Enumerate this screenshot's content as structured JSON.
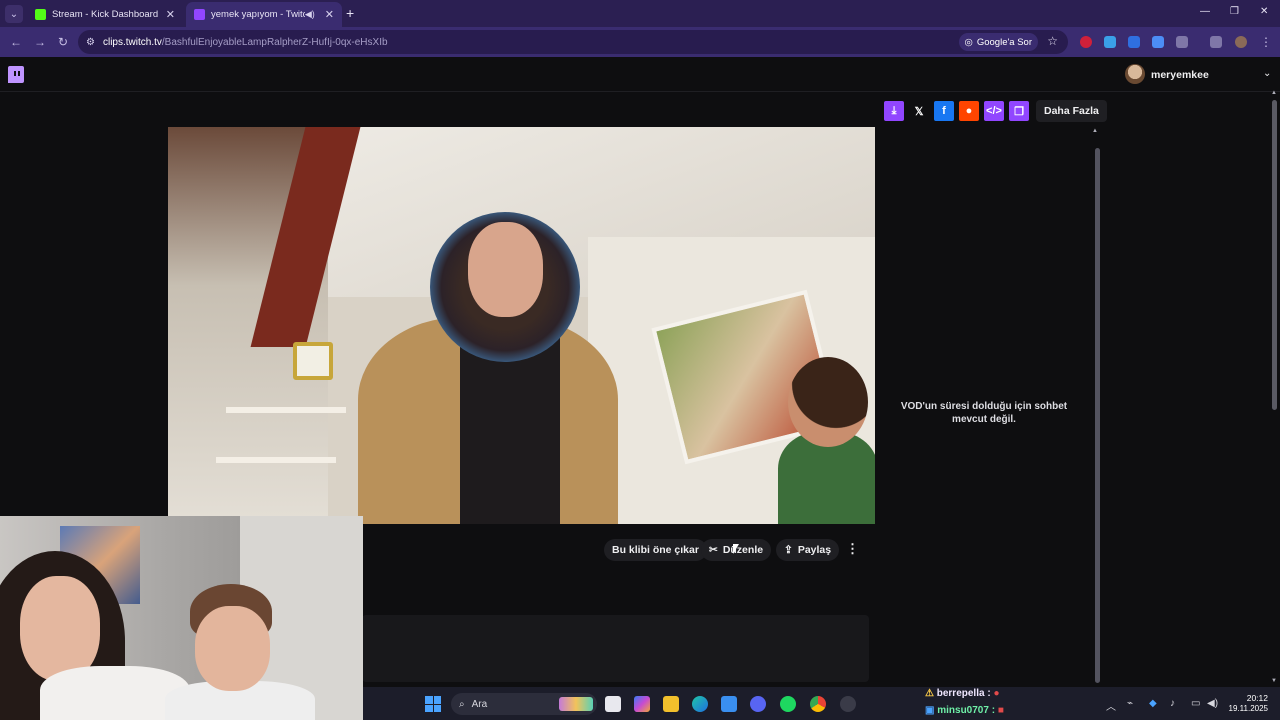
{
  "browser": {
    "tabs": [
      {
        "title": "Stream - Kick Dashboard",
        "active": false,
        "favicon_color": "#53fc18"
      },
      {
        "title": "yemek yapıyom - Twitch",
        "active": true,
        "favicon_color": "#9146ff"
      }
    ],
    "url_host": "clips.twitch.tv",
    "url_path": "/BashfulEnjoyableLampRalpherZ-HufIj-0qx-eHsXIb",
    "google_ask_label": "Google'a Sor",
    "accent_color": "#3a2c70"
  },
  "twitch": {
    "username": "meryemkee",
    "brand_color": "#9146ff",
    "more_label": "Daha Fazla",
    "actions": {
      "feature_clip": "Bu klibi öne çıkar",
      "edit": "Düzenle",
      "share": "Paylaş"
    },
    "chat_unavailable": "VOD'un süresi dolduğu için sohbet mevcut değil."
  },
  "taskbar": {
    "search_placeholder": "Ara",
    "chat_ticker": [
      {
        "user": "berrepella :"
      },
      {
        "user": "minsu0707 :"
      }
    ],
    "time": "20:12",
    "date": "19.11.2025"
  }
}
